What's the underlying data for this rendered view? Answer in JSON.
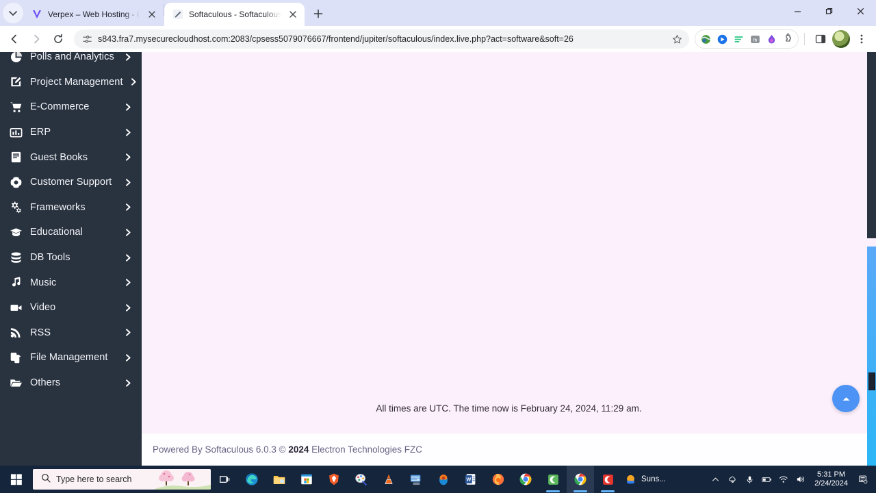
{
  "browser": {
    "tabs": [
      {
        "title": "Verpex – Web Hosting - Gold (V",
        "active": false,
        "favicon": "verpex-logo-icon"
      },
      {
        "title": "Softaculous - Softaculous - Wo",
        "active": true,
        "favicon": "softaculous-icon"
      }
    ],
    "new_tab_label": "+",
    "url": "s843.fra7.mysecurecloudhost.com:2083/cpsess5079076667/frontend/jupiter/softaculous/index.live.php?act=software&soft=26",
    "nav": {
      "back": "back-icon",
      "forward": "forward-icon",
      "reload": "reload-icon"
    },
    "site_info_icon": "site-settings-icon",
    "bookmark_icon": "star-icon",
    "extensions": [
      "globe-extension-icon",
      "video-download-extension-icon",
      "text-extension-icon",
      "fb-extension-icon",
      "fire-extension-icon",
      "puzzle-extensions-icon"
    ],
    "side_panel_icon": "side-panel-icon",
    "profile_icon": "profile-avatar",
    "menu_icon": "three-dot-menu-icon",
    "window_controls": {
      "minimize": "minimize-icon",
      "maximize": "maximize-icon",
      "close": "close-icon"
    }
  },
  "sidebar": {
    "items": [
      {
        "label": "Polls and Analytics",
        "icon": "pie-chart-icon"
      },
      {
        "label": "Project Management",
        "icon": "edit-square-icon"
      },
      {
        "label": "E-Commerce",
        "icon": "shopping-cart-icon"
      },
      {
        "label": "ERP",
        "icon": "bar-chart-icon"
      },
      {
        "label": "Guest Books",
        "icon": "book-icon"
      },
      {
        "label": "Customer Support",
        "icon": "life-ring-icon"
      },
      {
        "label": "Frameworks",
        "icon": "gears-icon"
      },
      {
        "label": "Educational",
        "icon": "graduation-cap-icon"
      },
      {
        "label": "DB Tools",
        "icon": "database-icon"
      },
      {
        "label": "Music",
        "icon": "music-note-icon"
      },
      {
        "label": "Video",
        "icon": "video-camera-icon"
      },
      {
        "label": "RSS",
        "icon": "rss-icon"
      },
      {
        "label": "File Management",
        "icon": "files-icon"
      },
      {
        "label": "Others",
        "icon": "folder-open-icon"
      }
    ],
    "chevron_icon": "chevron-right-icon"
  },
  "content": {
    "times_note": "All times are UTC. The time now is February 24, 2024, 11:29 am.",
    "footer_prefix": "Powered By Softaculous 6.0.3 © ",
    "footer_year": "2024",
    "footer_suffix": " Electron Technologies FZC",
    "scroll_top_icon": "scroll-to-top-icon"
  },
  "taskbar": {
    "start_icon": "windows-start-icon",
    "search_placeholder": "Type here to search",
    "search_icon": "search-icon",
    "task_view_icon": "task-view-icon",
    "apps": [
      "edge-icon",
      "file-explorer-icon",
      "microsoft-store-icon",
      "brave-icon",
      "paint-icon",
      "vlc-icon",
      "remote-desktop-icon",
      "thunderbird-icon",
      "word-icon",
      "firefox-icon",
      "chrome-icon",
      "camtasia-icon",
      "chrome-active-icon",
      "camtasia-editor-icon"
    ],
    "weather_label": "Suns...",
    "weather_icon": "sun-cloud-icon",
    "tray": [
      "show-hidden-icons-icon",
      "onedrive-icon",
      "microphone-icon",
      "battery-icon",
      "wifi-icon",
      "volume-icon"
    ],
    "time": "5:31 PM",
    "date": "2/24/2024",
    "notification_icon": "notification-center-icon"
  },
  "colors": {
    "sidebar_bg": "#29323f",
    "content_bg": "#fdf0fd",
    "accent_blue": "#4c93f5",
    "tabstrip_bg": "#dde1f7"
  }
}
